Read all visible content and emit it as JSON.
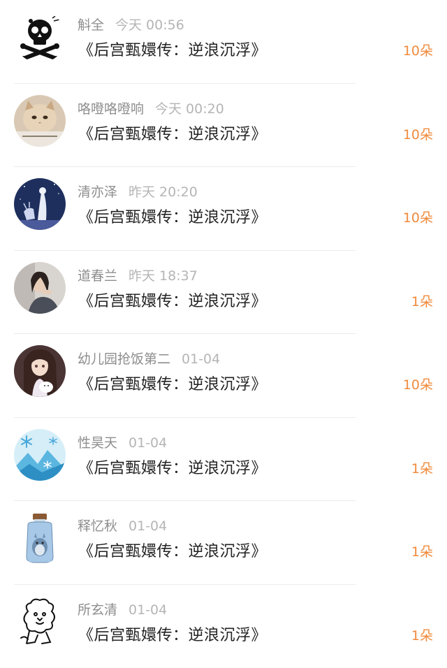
{
  "accent_color": "#f08a3c",
  "gifts": [
    {
      "name": "斛全",
      "time": "今天 00:56",
      "title": "《后宫甄嬛传：逆浪沉浮》",
      "count": "10朵",
      "avatar_icon": "skull-crossbones-icon"
    },
    {
      "name": "咯噔咯噔响",
      "time": "今天 00:20",
      "title": "《后宫甄嬛传：逆浪沉浮》",
      "count": "10朵",
      "avatar_icon": "cat-photo-icon"
    },
    {
      "name": "清亦泽",
      "time": "昨天 20:20",
      "title": "《后宫甄嬛传：逆浪沉浮》",
      "count": "10朵",
      "avatar_icon": "night-deer-icon"
    },
    {
      "name": "道春兰",
      "time": "昨天 18:37",
      "title": "《后宫甄嬛传：逆浪沉浮》",
      "count": "1朵",
      "avatar_icon": "girl-photo-icon"
    },
    {
      "name": "幼儿园抢饭第二",
      "time": "01-04",
      "title": "《后宫甄嬛传：逆浪沉浮》",
      "count": "10朵",
      "avatar_icon": "anime-girl-icon"
    },
    {
      "name": "性昊天",
      "time": "01-04",
      "title": "《后宫甄嬛传：逆浪沉浮》",
      "count": "1朵",
      "avatar_icon": "snowflake-icon"
    },
    {
      "name": "释忆秋",
      "time": "01-04",
      "title": "《后宫甄嬛传：逆浪沉浮》",
      "count": "1朵",
      "avatar_icon": "totoro-jar-icon"
    },
    {
      "name": "所玄清",
      "time": "01-04",
      "title": "《后宫甄嬛传：逆浪沉浮》",
      "count": "1朵",
      "avatar_icon": "lion-sketch-icon"
    }
  ]
}
